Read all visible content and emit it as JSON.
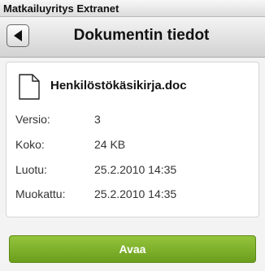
{
  "app": {
    "title": "Matkailuyritys Extranet"
  },
  "header": {
    "title": "Dokumentin tiedot",
    "back_icon": "chevron-left-icon"
  },
  "document": {
    "icon": "document-icon",
    "name": "Henkilöstökäsikirja.doc",
    "fields": [
      {
        "label": "Versio:",
        "value": "3"
      },
      {
        "label": "Koko:",
        "value": "24 KB"
      },
      {
        "label": "Luotu:",
        "value": "25.2.2010 14:35"
      },
      {
        "label": "Muokattu:",
        "value": "25.2.2010 14:35"
      }
    ]
  },
  "actions": {
    "open_label": "Avaa",
    "accent_color": "#7fb02b"
  }
}
